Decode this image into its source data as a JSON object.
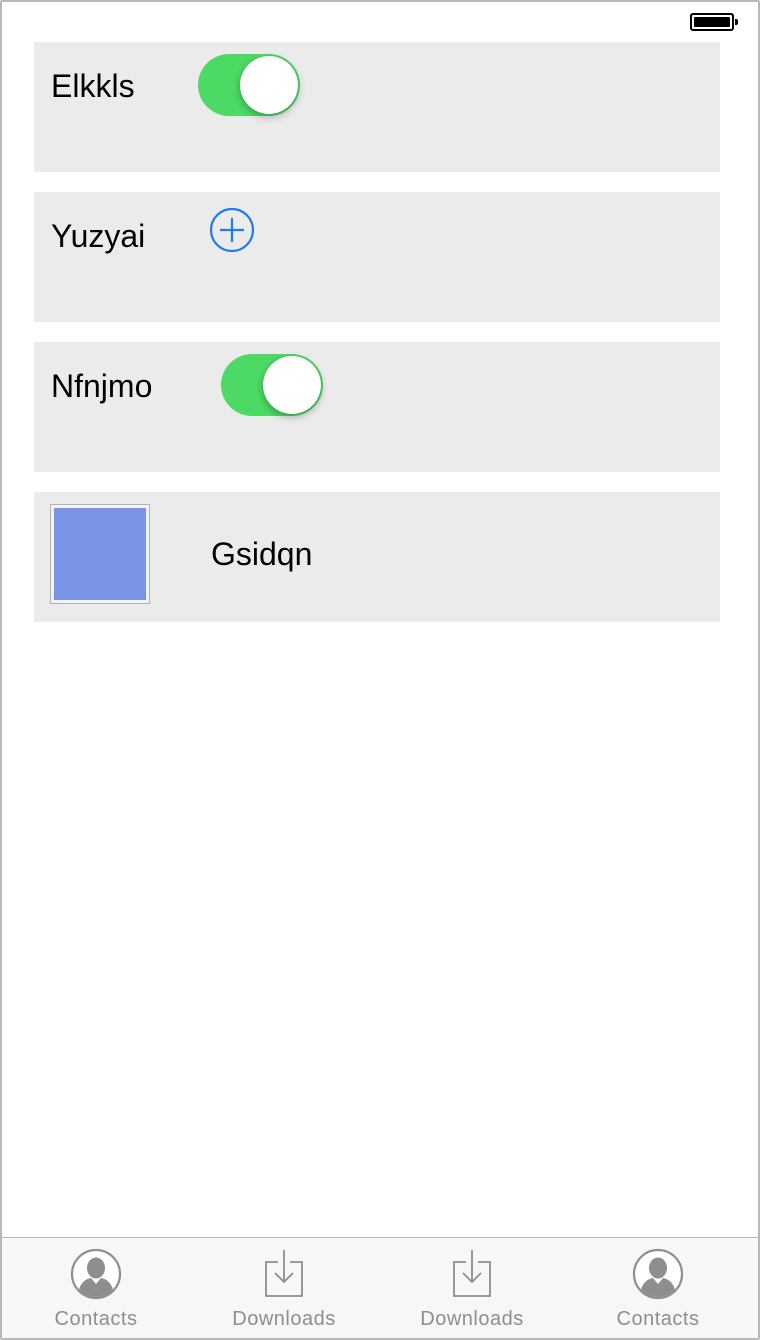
{
  "status_bar": {
    "battery_icon": "battery-full-icon"
  },
  "rows": [
    {
      "label": "Elkkls",
      "control": "toggle",
      "toggle_on": true
    },
    {
      "label": "Yuzyai",
      "control": "add-button",
      "icon": "plus-circle-icon"
    },
    {
      "label": "Nfnjmo",
      "control": "toggle",
      "toggle_on": true
    },
    {
      "label": "Gsidqn",
      "control": "image",
      "image_color": "#7a94e6"
    }
  ],
  "tab_bar": {
    "tabs": [
      {
        "label": "Contacts",
        "icon": "contact-icon"
      },
      {
        "label": "Downloads",
        "icon": "download-icon"
      },
      {
        "label": "Downloads",
        "icon": "download-icon"
      },
      {
        "label": "Contacts",
        "icon": "contact-icon"
      }
    ]
  },
  "colors": {
    "toggle_on": "#4cd964",
    "accent": "#1a7cf0",
    "card_bg": "#ebebeb",
    "tab_icon": "#8e8e8e"
  }
}
